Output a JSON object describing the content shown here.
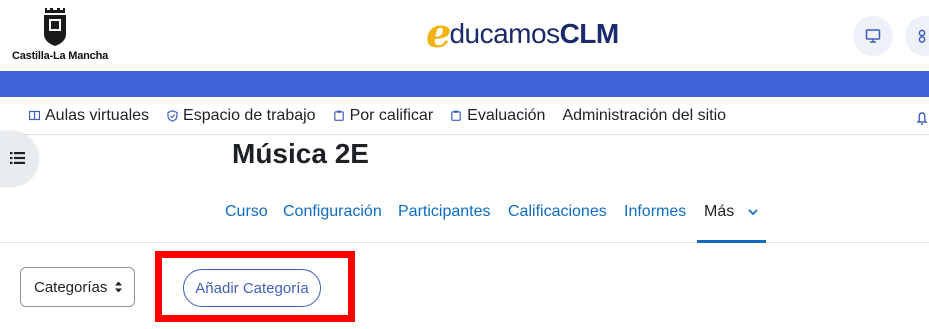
{
  "header": {
    "org_name": "Castilla-La Mancha",
    "brand_prefix": "e",
    "brand_middle": "ducamos",
    "brand_suffix": "CLM",
    "icons": [
      "monitor-icon",
      "users-icon"
    ]
  },
  "primary_nav": {
    "items": [
      {
        "label": "Aulas virtuales",
        "icon": "grid-icon"
      },
      {
        "label": "Espacio de trabajo",
        "icon": "shield-check-icon"
      },
      {
        "label": "Por calificar",
        "icon": "clipboard-icon"
      },
      {
        "label": "Evaluación",
        "icon": "clipboard-list-icon"
      },
      {
        "label": "Administración del sitio",
        "icon": ""
      }
    ],
    "right_icon": "bell-icon"
  },
  "drawer": {
    "icon": "list-icon"
  },
  "page": {
    "title": "Música 2E"
  },
  "secondary_nav": {
    "items": [
      "Curso",
      "Configuración",
      "Participantes",
      "Calificaciones",
      "Informes"
    ],
    "more_label": "Más",
    "active": "Más"
  },
  "controls": {
    "select_value": "Categorías",
    "add_button_label": "Añadir Categoría"
  },
  "colors": {
    "band": "#3f62db",
    "link": "#0f6cbf",
    "highlight": "#ff0000",
    "brand_orange": "#f3b215",
    "brand_navy": "#1b2a6b"
  }
}
